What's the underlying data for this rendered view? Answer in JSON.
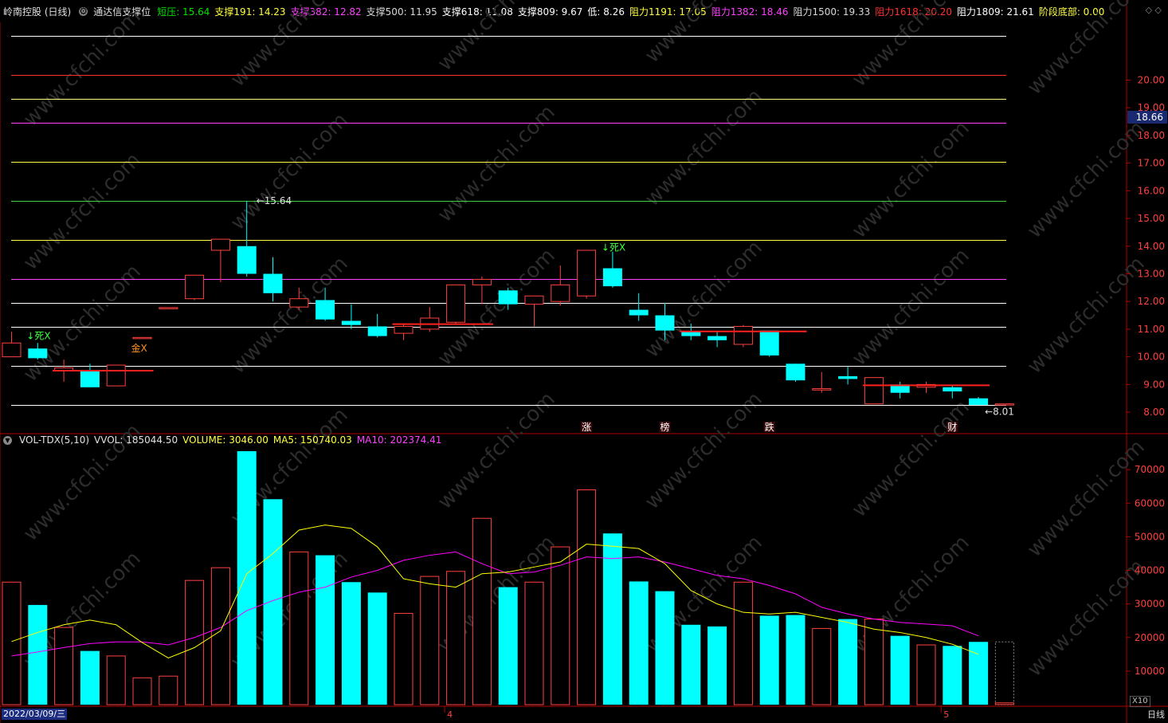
{
  "header": {
    "title": "岭南控股 (日线)",
    "indicator_name": "通达信支撑位",
    "items": [
      {
        "label": "短压: 15.64",
        "color": "#00e000"
      },
      {
        "label": "支撑191: 14.23",
        "color": "#ffff40"
      },
      {
        "label": "支撑382: 12.82",
        "color": "#ff40ff"
      },
      {
        "label": "支撑500: 11.95",
        "color": "#d8d8d8"
      },
      {
        "label": "支撑618: 11.08",
        "color": "#ffffff"
      },
      {
        "label": "支撑809: 9.67",
        "color": "#ffffff"
      },
      {
        "label": "低: 8.26",
        "color": "#ffffff"
      },
      {
        "label": "阻力1191: 17.05",
        "color": "#ffff40"
      },
      {
        "label": "阻力1382: 18.46",
        "color": "#ff40ff"
      },
      {
        "label": "阻力1500: 19.33",
        "color": "#d8d8d8"
      },
      {
        "label": "阻力1618: 20.20",
        "color": "#ff3030"
      },
      {
        "label": "阻力1809: 21.61",
        "color": "#ffffff"
      },
      {
        "label": "阶段底部: 0.00",
        "color": "#ffff40"
      }
    ]
  },
  "volume_header": {
    "name": "VOL-TDX(5,10)",
    "vvol": "VVOL: 185044.50",
    "volume": "VOLUME: 3046.00",
    "ma5": "MA5: 150740.03",
    "ma10": "MA10: 202374.41"
  },
  "colors": {
    "up": "#ff4040",
    "down": "#00ffff",
    "ma5": "#ffff00",
    "ma10": "#ff00ff",
    "frame": "#b00000",
    "axis_text": "#ff4040"
  },
  "price_axis": {
    "ticks": [
      "20.00",
      "19.00",
      "18.00",
      "17.00",
      "16.00",
      "15.00",
      "14.00",
      "13.00",
      "12.00",
      "11.00",
      "10.00",
      "9.00",
      "8.00"
    ],
    "current": "18.66"
  },
  "volume_axis": {
    "ticks": [
      "70000",
      "60000",
      "50000",
      "40000",
      "30000",
      "20000",
      "10000"
    ],
    "multiplier": "X10"
  },
  "price_range": [
    7.8,
    21.8
  ],
  "volume_range": [
    0,
    75500
  ],
  "support_lines": [
    {
      "value": 21.61,
      "color": "#ffffff"
    },
    {
      "value": 20.2,
      "color": "#ff3030"
    },
    {
      "value": 19.33,
      "color": "#ffff80"
    },
    {
      "value": 18.46,
      "color": "#ff40ff"
    },
    {
      "value": 17.05,
      "color": "#ffff40"
    },
    {
      "value": 15.64,
      "color": "#40d040"
    },
    {
      "value": 14.23,
      "color": "#ffff40"
    },
    {
      "value": 12.82,
      "color": "#ff40ff"
    },
    {
      "value": 11.95,
      "color": "#ffffff"
    },
    {
      "value": 11.08,
      "color": "#ffffff"
    },
    {
      "value": 9.67,
      "color": "#ffffff"
    },
    {
      "value": 8.26,
      "color": "#ffffff"
    }
  ],
  "candles": [
    {
      "o": 10.0,
      "c": 10.5,
      "h": 10.9,
      "l": 10.0,
      "v": 36500
    },
    {
      "o": 10.3,
      "c": 9.95,
      "h": 10.5,
      "l": 9.9,
      "v": 29700
    },
    {
      "o": 9.5,
      "c": 9.6,
      "h": 9.9,
      "l": 9.1,
      "v": 23000
    },
    {
      "o": 9.5,
      "c": 8.9,
      "h": 9.75,
      "l": 8.9,
      "v": 16000
    },
    {
      "o": 8.95,
      "c": 9.7,
      "h": 9.7,
      "l": 8.95,
      "v": 14500
    },
    {
      "o": 10.7,
      "c": 10.7,
      "h": 10.7,
      "l": 10.7,
      "v": 8000
    },
    {
      "o": 11.78,
      "c": 11.78,
      "h": 11.78,
      "l": 11.78,
      "v": 8500
    },
    {
      "o": 12.1,
      "c": 12.95,
      "h": 12.95,
      "l": 12.05,
      "v": 37000
    },
    {
      "o": 13.85,
      "c": 14.25,
      "h": 14.25,
      "l": 12.7,
      "v": 40800
    },
    {
      "o": 14.0,
      "c": 13.0,
      "h": 15.64,
      "l": 12.9,
      "v": 75500
    },
    {
      "o": 13.0,
      "c": 12.3,
      "h": 13.6,
      "l": 12.0,
      "v": 61200
    },
    {
      "o": 11.8,
      "c": 12.1,
      "h": 12.5,
      "l": 11.7,
      "v": 45500
    },
    {
      "o": 12.05,
      "c": 11.35,
      "h": 12.5,
      "l": 11.3,
      "v": 44500
    },
    {
      "o": 11.3,
      "c": 11.15,
      "h": 11.9,
      "l": 11.0,
      "v": 36500
    },
    {
      "o": 11.1,
      "c": 10.75,
      "h": 11.55,
      "l": 10.7,
      "v": 33400
    },
    {
      "o": 10.85,
      "c": 11.1,
      "h": 11.2,
      "l": 10.6,
      "v": 27200
    },
    {
      "o": 11.0,
      "c": 11.4,
      "h": 11.8,
      "l": 10.9,
      "v": 38200
    },
    {
      "o": 11.25,
      "c": 12.6,
      "h": 12.6,
      "l": 11.2,
      "v": 39700
    },
    {
      "o": 12.6,
      "c": 12.8,
      "h": 12.9,
      "l": 11.9,
      "v": 55500
    },
    {
      "o": 12.4,
      "c": 11.9,
      "h": 12.5,
      "l": 11.7,
      "v": 35000
    },
    {
      "o": 11.9,
      "c": 12.2,
      "h": 12.2,
      "l": 11.1,
      "v": 36500
    },
    {
      "o": 12.0,
      "c": 12.6,
      "h": 13.3,
      "l": 11.85,
      "v": 47000
    },
    {
      "o": 12.2,
      "c": 13.85,
      "h": 13.85,
      "l": 12.1,
      "v": 64000
    },
    {
      "o": 13.2,
      "c": 12.55,
      "h": 13.8,
      "l": 12.5,
      "v": 51000
    },
    {
      "o": 11.7,
      "c": 11.5,
      "h": 12.3,
      "l": 11.3,
      "v": 36700
    },
    {
      "o": 11.5,
      "c": 10.95,
      "h": 11.95,
      "l": 10.6,
      "v": 33800
    },
    {
      "o": 10.9,
      "c": 10.75,
      "h": 11.2,
      "l": 10.6,
      "v": 23800
    },
    {
      "o": 10.75,
      "c": 10.6,
      "h": 10.9,
      "l": 10.35,
      "v": 23300
    },
    {
      "o": 10.45,
      "c": 11.1,
      "h": 11.15,
      "l": 10.35,
      "v": 36500
    },
    {
      "o": 10.95,
      "c": 10.05,
      "h": 10.95,
      "l": 10.0,
      "v": 26500
    },
    {
      "o": 9.75,
      "c": 9.15,
      "h": 9.75,
      "l": 9.1,
      "v": 26700
    },
    {
      "o": 8.8,
      "c": 8.85,
      "h": 9.45,
      "l": 8.7,
      "v": 22700
    },
    {
      "o": 9.3,
      "c": 9.2,
      "h": 9.65,
      "l": 9.0,
      "v": 25500
    },
    {
      "o": 8.3,
      "c": 9.25,
      "h": 9.25,
      "l": 8.3,
      "v": 25500
    },
    {
      "o": 9.0,
      "c": 8.7,
      "h": 9.1,
      "l": 8.5,
      "v": 20500
    },
    {
      "o": 8.9,
      "c": 9.0,
      "h": 9.1,
      "l": 8.7,
      "v": 17800
    },
    {
      "o": 8.9,
      "c": 8.75,
      "h": 8.95,
      "l": 8.5,
      "v": 17500
    },
    {
      "o": 8.5,
      "c": 8.26,
      "h": 8.55,
      "l": 8.26,
      "v": 18700
    },
    {
      "o": 8.3,
      "c": 8.3,
      "h": 8.3,
      "l": 8.3,
      "v": 300
    }
  ],
  "ma5": [
    18800,
    21500,
    23800,
    25200,
    23800,
    18500,
    13900,
    17000,
    22000,
    39000,
    45000,
    52000,
    53500,
    52500,
    47000,
    37500,
    36000,
    35000,
    39000,
    39500,
    41000,
    42500,
    47800,
    47200,
    46500,
    42000,
    34000,
    30000,
    27500,
    27000,
    27500,
    26000,
    24500,
    22500,
    21500,
    20000,
    18000,
    15000
  ],
  "ma10": [
    14500,
    15700,
    17000,
    18200,
    18700,
    18700,
    17800,
    20000,
    23000,
    28000,
    31000,
    33500,
    35000,
    38000,
    40000,
    43000,
    44500,
    45500,
    42000,
    39000,
    39500,
    41500,
    44000,
    43500,
    44000,
    42500,
    40500,
    38500,
    37500,
    35500,
    33000,
    29000,
    27000,
    25500,
    24500,
    24000,
    23500,
    20500
  ],
  "signals": [
    {
      "text": "↓死X",
      "index": 1,
      "price": 10.75,
      "color": "#40ff40"
    },
    {
      "text": "金X",
      "index": 5,
      "price": 10.3,
      "color": "#ff9020"
    },
    {
      "text": "↓死X",
      "index": 23,
      "price": 13.95,
      "color": "#40ff40"
    }
  ],
  "peak_label": {
    "text": "15.64",
    "index": 9,
    "price": 15.64
  },
  "low_label": {
    "text": "8.01",
    "index": 37,
    "price": 8.01
  },
  "events": [
    {
      "text": "涨",
      "index": 22
    },
    {
      "text": "榜",
      "index": 25
    },
    {
      "text": "跌",
      "index": 29
    },
    {
      "text": "财",
      "index": 36
    }
  ],
  "date_axis": {
    "current_date": "2022/03/09/三",
    "months": [
      {
        "label": "4",
        "index": 17
      },
      {
        "label": "5",
        "index": 36
      }
    ]
  },
  "period": "日线",
  "watermark": "www.cfchi.com",
  "window_controls": "◇  ◇"
}
